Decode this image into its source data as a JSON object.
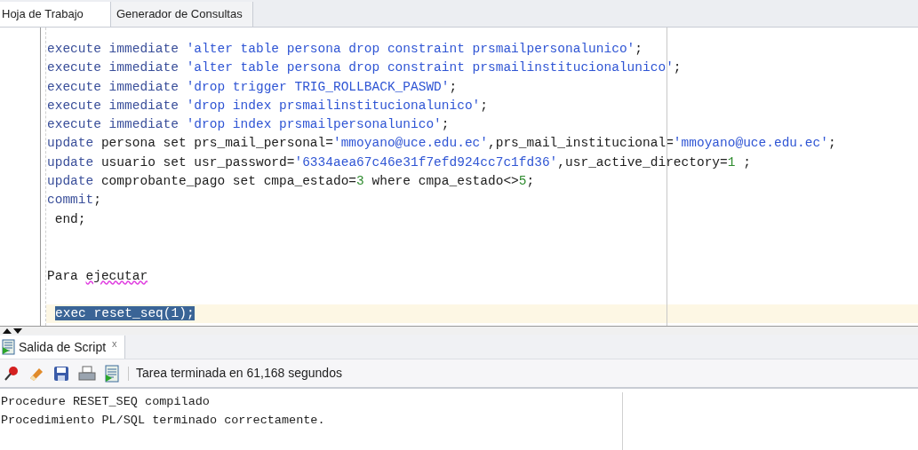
{
  "tabs": [
    {
      "label": "Hoja de Trabajo",
      "selected": true
    },
    {
      "label": "Generador de Consultas",
      "selected": false
    }
  ],
  "editor": {
    "lines": [
      {
        "kind": "code",
        "current": false,
        "tokens": [
          {
            "kind": "keyword",
            "text": "execute immediate "
          },
          {
            "kind": "string",
            "text": "'alter table persona drop constraint prsmailpersonalunico'"
          },
          {
            "kind": "plain",
            "text": ";"
          }
        ]
      },
      {
        "kind": "code",
        "current": false,
        "tokens": [
          {
            "kind": "keyword",
            "text": "execute immediate "
          },
          {
            "kind": "string",
            "text": "'alter table persona drop constraint prsmailinstitucionalunico'"
          },
          {
            "kind": "plain",
            "text": ";"
          }
        ]
      },
      {
        "kind": "code",
        "current": false,
        "tokens": [
          {
            "kind": "keyword",
            "text": "execute immediate "
          },
          {
            "kind": "string",
            "text": "'drop trigger TRIG_ROLLBACK_PASWD'"
          },
          {
            "kind": "plain",
            "text": ";"
          }
        ]
      },
      {
        "kind": "code",
        "current": false,
        "tokens": [
          {
            "kind": "keyword",
            "text": "execute immediate "
          },
          {
            "kind": "string",
            "text": "'drop index prsmailinstitucionalunico'"
          },
          {
            "kind": "plain",
            "text": ";"
          }
        ]
      },
      {
        "kind": "code",
        "current": false,
        "tokens": [
          {
            "kind": "keyword",
            "text": "execute immediate "
          },
          {
            "kind": "string",
            "text": "'drop index prsmailpersonalunico'"
          },
          {
            "kind": "plain",
            "text": ";"
          }
        ]
      },
      {
        "kind": "code",
        "current": false,
        "tokens": [
          {
            "kind": "keyword",
            "text": "update "
          },
          {
            "kind": "plain",
            "text": "persona set prs_mail_personal="
          },
          {
            "kind": "string",
            "text": "'mmoyano@uce.edu.ec'"
          },
          {
            "kind": "plain",
            "text": ",prs_mail_institucional="
          },
          {
            "kind": "string",
            "text": "'mmoyano@uce.edu.ec'"
          },
          {
            "kind": "plain",
            "text": ";"
          }
        ]
      },
      {
        "kind": "code",
        "current": false,
        "tokens": [
          {
            "kind": "keyword",
            "text": "update "
          },
          {
            "kind": "plain",
            "text": "usuario set usr_password="
          },
          {
            "kind": "string",
            "text": "'6334aea67c46e31f7efd924cc7c1fd36'"
          },
          {
            "kind": "plain",
            "text": ",usr_active_directory="
          },
          {
            "kind": "number",
            "text": "1"
          },
          {
            "kind": "plain",
            "text": " ;"
          }
        ]
      },
      {
        "kind": "code",
        "current": false,
        "tokens": [
          {
            "kind": "keyword",
            "text": "update "
          },
          {
            "kind": "plain",
            "text": "comprobante_pago set cmpa_estado="
          },
          {
            "kind": "number",
            "text": "3"
          },
          {
            "kind": "plain",
            "text": " where cmpa_estado<>"
          },
          {
            "kind": "number",
            "text": "5"
          },
          {
            "kind": "plain",
            "text": ";"
          }
        ]
      },
      {
        "kind": "code",
        "current": false,
        "tokens": [
          {
            "kind": "keyword",
            "text": "commit"
          },
          {
            "kind": "plain",
            "text": ";"
          }
        ]
      },
      {
        "kind": "code",
        "current": false,
        "tokens": [
          {
            "kind": "plain",
            "text": " end;"
          }
        ]
      },
      {
        "kind": "blank",
        "current": false
      },
      {
        "kind": "blank",
        "current": false
      },
      {
        "kind": "code",
        "current": false,
        "tokens": [
          {
            "kind": "plain",
            "text": "Para "
          },
          {
            "kind": "misspelled",
            "text": "ejecutar"
          }
        ]
      },
      {
        "kind": "blank",
        "current": false
      },
      {
        "kind": "code",
        "current": true,
        "tokens": [
          {
            "kind": "selected",
            "text": "exec reset_seq(1);"
          }
        ]
      }
    ]
  },
  "output_panel": {
    "tab": {
      "label": "Salida de Script",
      "selected": true,
      "close": "x"
    },
    "status": "Tarea terminada en 61,168 segundos",
    "lines": [
      "Procedure RESET_SEQ compilado",
      "Procedimiento PL/SQL terminado correctamente."
    ]
  }
}
